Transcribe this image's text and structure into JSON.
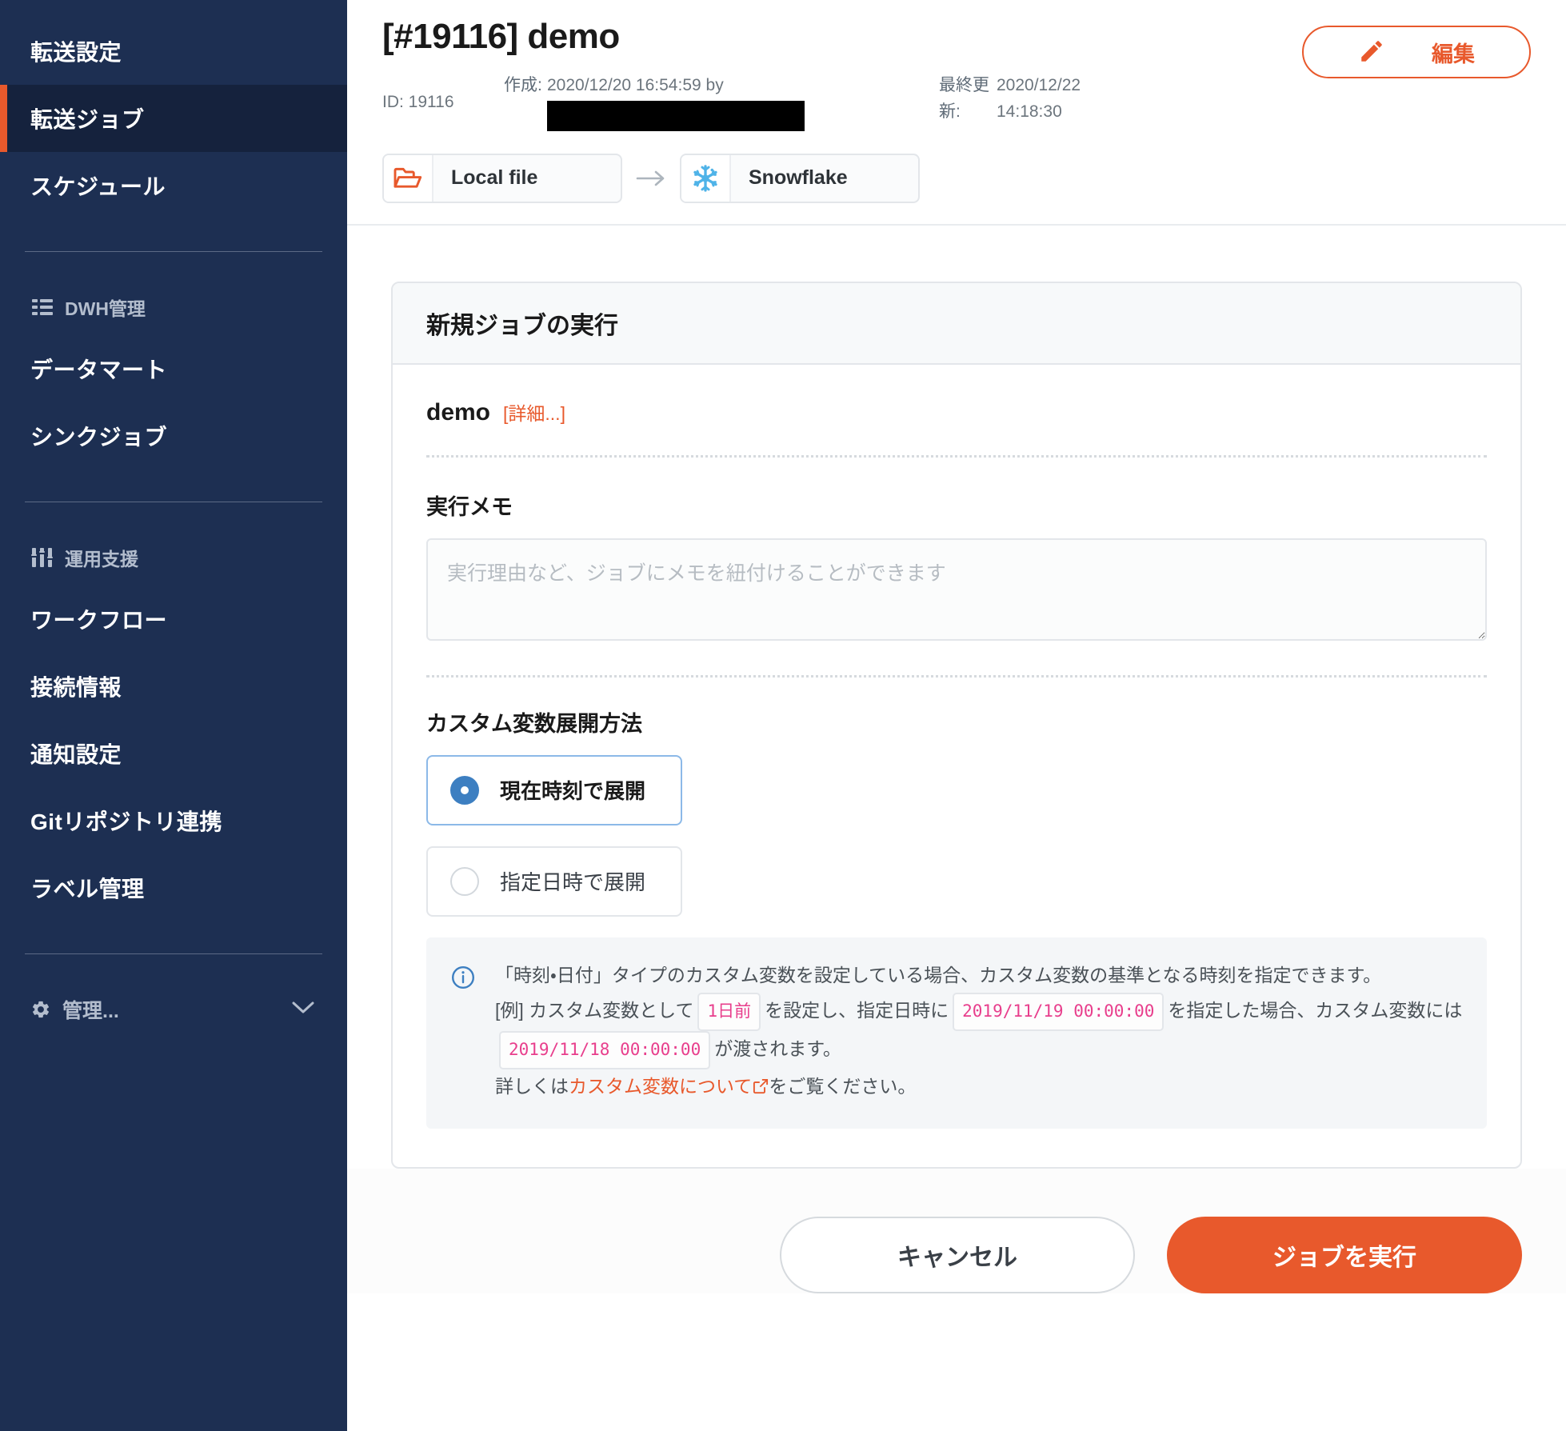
{
  "sidebar": {
    "primary_items": [
      {
        "label": "転送設定",
        "name": "sidebar-item-transfer-settings",
        "active": false
      },
      {
        "label": "転送ジョブ",
        "name": "sidebar-item-transfer-jobs",
        "active": true
      },
      {
        "label": "スケジュール",
        "name": "sidebar-item-schedule",
        "active": false
      }
    ],
    "group_dwh": {
      "label": "DWH管理",
      "icon": "database-list-icon",
      "items": [
        {
          "label": "データマート",
          "name": "sidebar-item-data-mart"
        },
        {
          "label": "シンクジョブ",
          "name": "sidebar-item-sync-job"
        }
      ]
    },
    "group_ops": {
      "label": "運用支援",
      "icon": "sliders-icon",
      "items": [
        {
          "label": "ワークフロー",
          "name": "sidebar-item-workflow"
        },
        {
          "label": "接続情報",
          "name": "sidebar-item-connections"
        },
        {
          "label": "通知設定",
          "name": "sidebar-item-notifications"
        },
        {
          "label": "Gitリポジトリ連携",
          "name": "sidebar-item-git-repository"
        },
        {
          "label": "ラベル管理",
          "name": "sidebar-item-label-management"
        }
      ]
    },
    "admin": {
      "label": "管理...",
      "icon": "gear-icon",
      "chevron": "chevron-down-icon"
    }
  },
  "header": {
    "title": "[#19116] demo",
    "id_label": "ID: 19116",
    "created_label": "作成:",
    "created_value": "2020/12/20 16:54:59 by",
    "created_user_redacted": "",
    "updated_label": "最終更新:",
    "updated_value_line1": "2020/12/22",
    "updated_value_line2": "14:18:30",
    "edit_button_label": "編集",
    "edit_button_icon": "pencil-icon",
    "edit_button_color": "#e8592c",
    "connector_source": {
      "label": "Local file",
      "icon": "folder-open-icon",
      "icon_color": "#e8592c"
    },
    "connector_arrow": "arrow-right-icon",
    "connector_dest": {
      "label": "Snowflake",
      "icon": "snowflake-icon",
      "icon_color": "#4fb3e8"
    }
  },
  "card": {
    "title": "新規ジョブの実行",
    "job_name": "demo",
    "job_detail_link": "[詳細...]",
    "memo": {
      "label": "実行メモ",
      "value": "",
      "placeholder": "実行理由など、ジョブにメモを紐付けることができます"
    },
    "custom_var": {
      "label": "カスタム変数展開方法",
      "options": [
        {
          "label": "現在時刻で展開",
          "name": "radio-expand-current-time",
          "selected": true
        },
        {
          "label": "指定日時で展開",
          "name": "radio-expand-specified-datetime",
          "selected": false
        }
      ]
    },
    "info": {
      "icon": "info-circle-icon",
      "line1": "「時刻・日付」タイプのカスタム変数を設定している場合、カスタム変数の基準となる時刻を指定できます。",
      "line2_a": "[例] カスタム変数として",
      "chip1": "1日前",
      "line2_b": "を設定し、指定日時に",
      "chip2": "2019/11/19 00:00:00",
      "line2_c": "を指定した場合、カスタム変数には",
      "chip3": "2019/11/18 00:00:00",
      "line2_d": "が渡されます。",
      "line3_a": "詳しくは",
      "link_text": "カスタム変数について",
      "link_icon": "external-link-icon",
      "line3_b": "をご覧ください。"
    }
  },
  "footer": {
    "cancel_label": "キャンセル",
    "run_label": "ジョブを実行",
    "run_color": "#e8592c"
  }
}
